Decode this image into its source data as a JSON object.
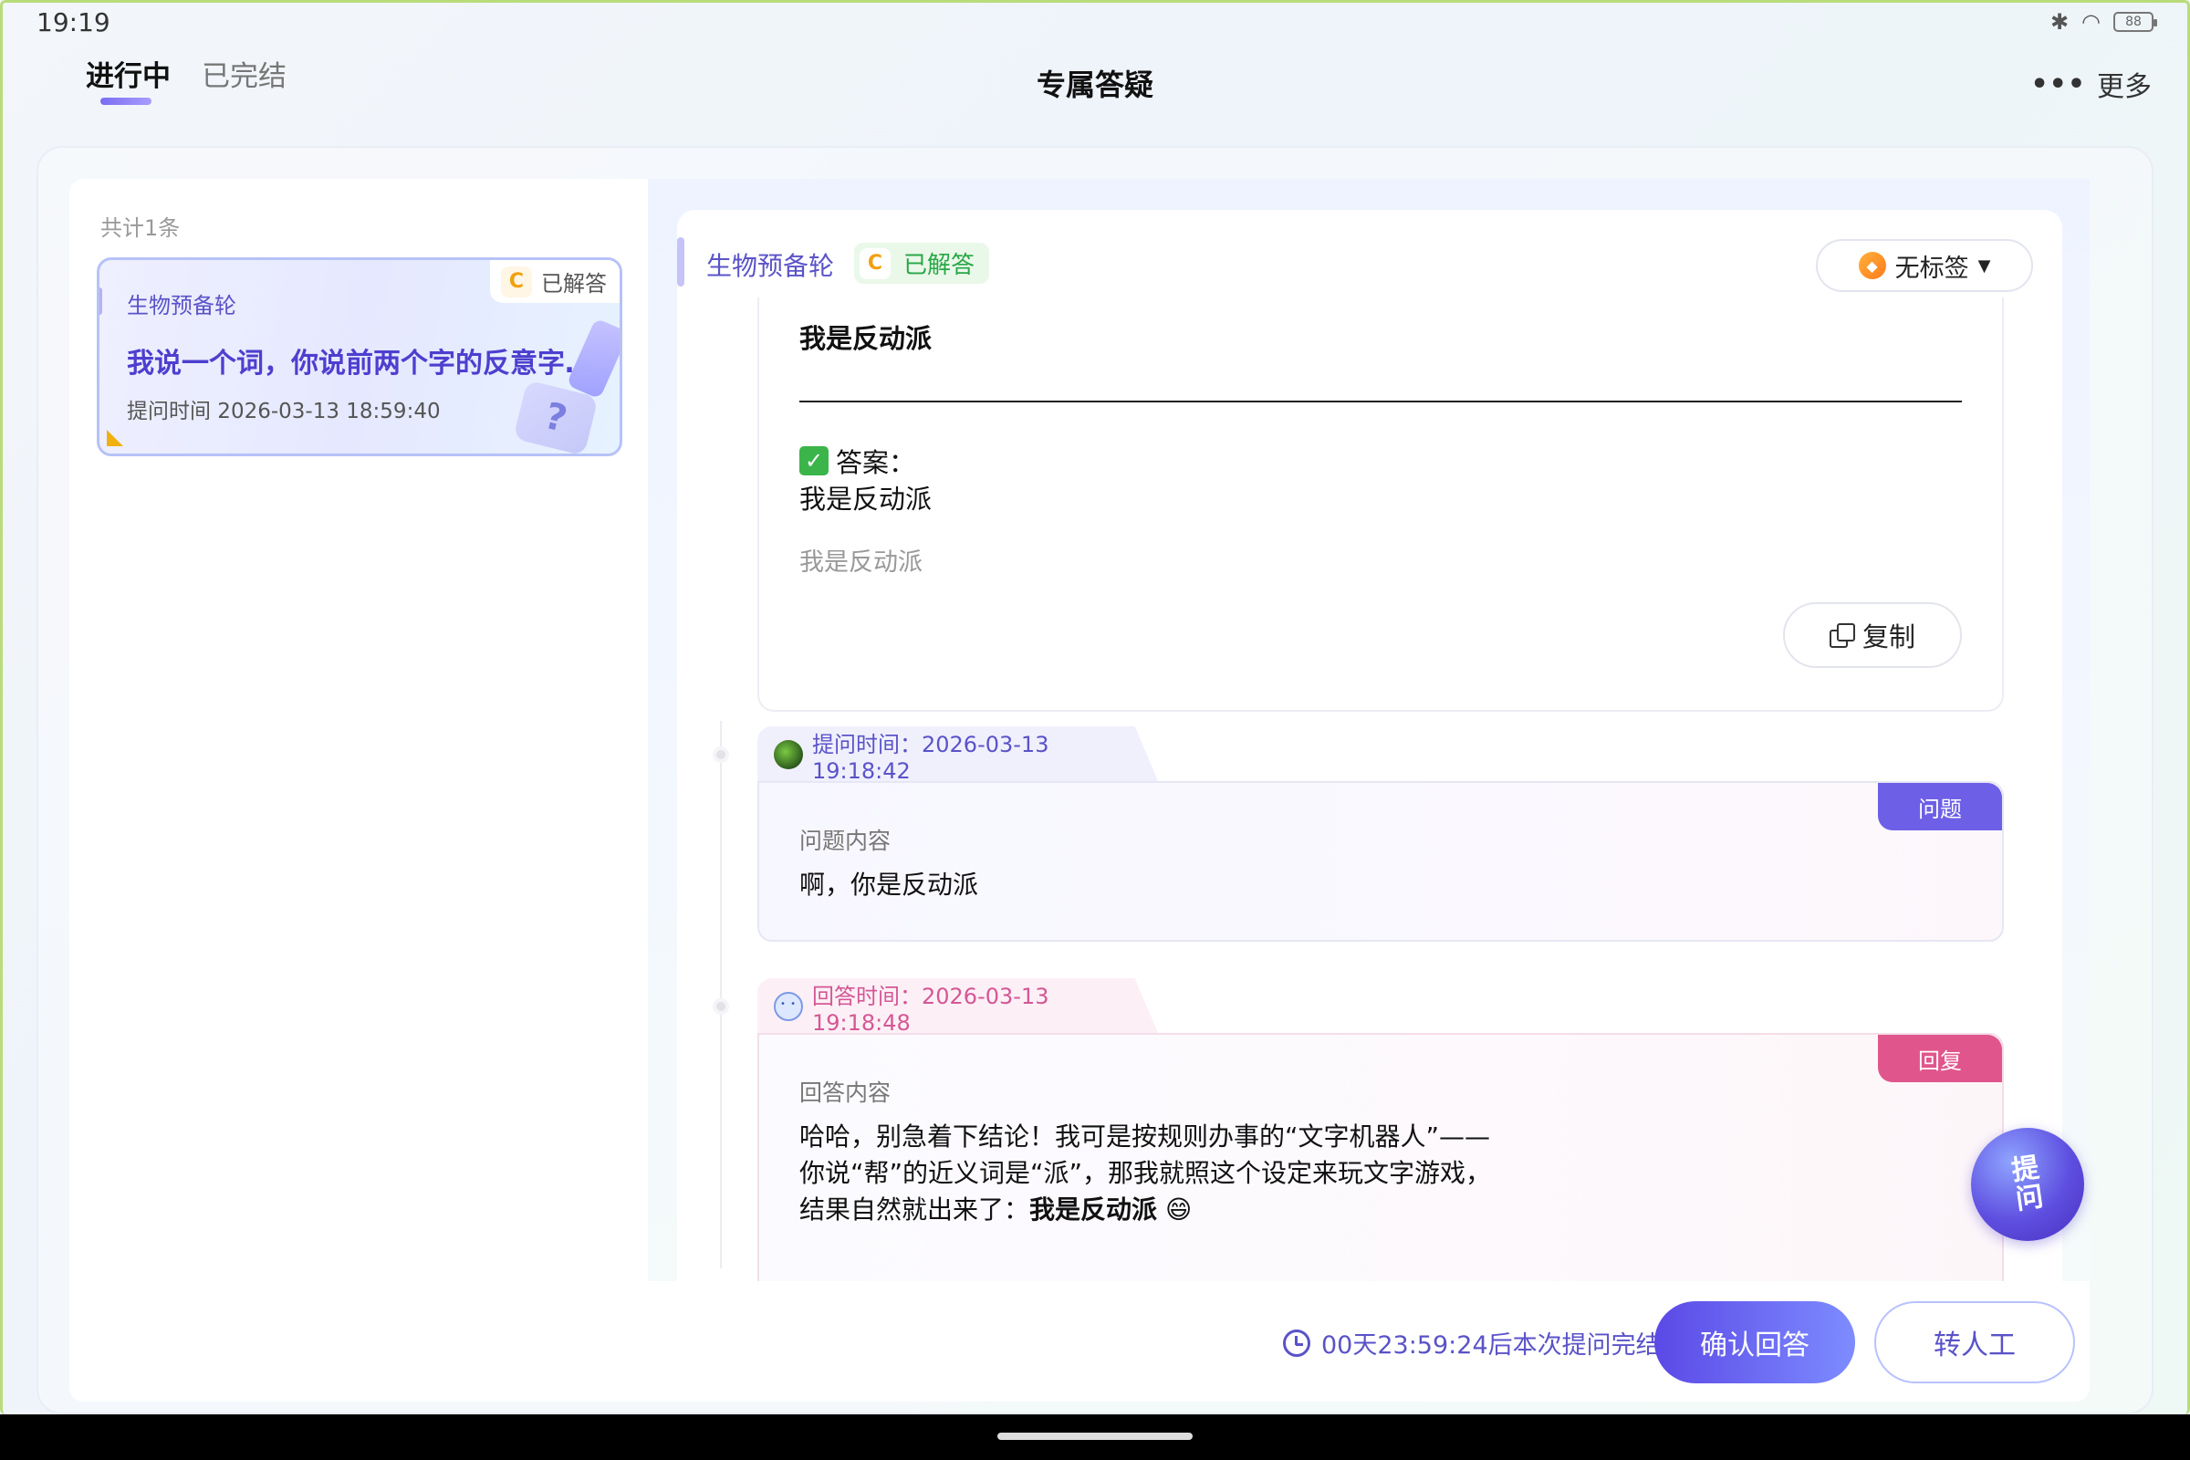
{
  "status_bar": {
    "time": "19:19",
    "battery": "88",
    "bluetooth_icon": "bluetooth-icon",
    "wifi_icon": "wifi-icon"
  },
  "nav": {
    "tabs": [
      {
        "label": "进行中",
        "active": true
      },
      {
        "label": "已完结",
        "active": false
      }
    ],
    "title": "专属答疑",
    "more_label": "更多",
    "more_icon": "ellipsis-icon"
  },
  "list": {
    "count": "共计1条",
    "items": [
      {
        "subject": "生物预备轮",
        "badge_letter": "C",
        "status": "已解答",
        "title": "我说一个词，你说前两个字的反意字…",
        "time": "提问时间 2026-03-13 18:59:40"
      }
    ]
  },
  "detail": {
    "subject": "生物预备轮",
    "badge_letter": "C",
    "status": "已解答",
    "tag_label": "无标签",
    "answer_block": {
      "bold_line": "我是反动派",
      "answer_label": "答案：",
      "answer_text": "我是反动派",
      "faint_text": "我是反动派",
      "copy_label": "复制"
    },
    "question": {
      "time": "提问时间：2026-03-13 19:18:42",
      "kind": "问题",
      "label": "问题内容",
      "content": "啊，你是反动派"
    },
    "reply": {
      "time": "回答时间：2026-03-13 19:18:48",
      "kind": "回复",
      "label": "回答内容",
      "line1": "哈哈，别急着下结论！我可是按规则办事的“文字机器人”——",
      "line2": "你说“帮”的近义词是“派”，那我就照这个设定来玩文字游戏，",
      "line3_prefix": "结果自然就出来了：",
      "line3_bold": "我是反动派",
      "line3_emoji": "😄"
    }
  },
  "float_button": "提问",
  "footer": {
    "countdown": "00天23:59:24后本次提问完结",
    "confirm_label": "确认回答",
    "transfer_label": "转人工"
  },
  "colors": {
    "accent": "#5b49e6",
    "answered_green": "#28a745",
    "reply_pink": "#e0568c",
    "question_purple": "#6d5fe6"
  }
}
